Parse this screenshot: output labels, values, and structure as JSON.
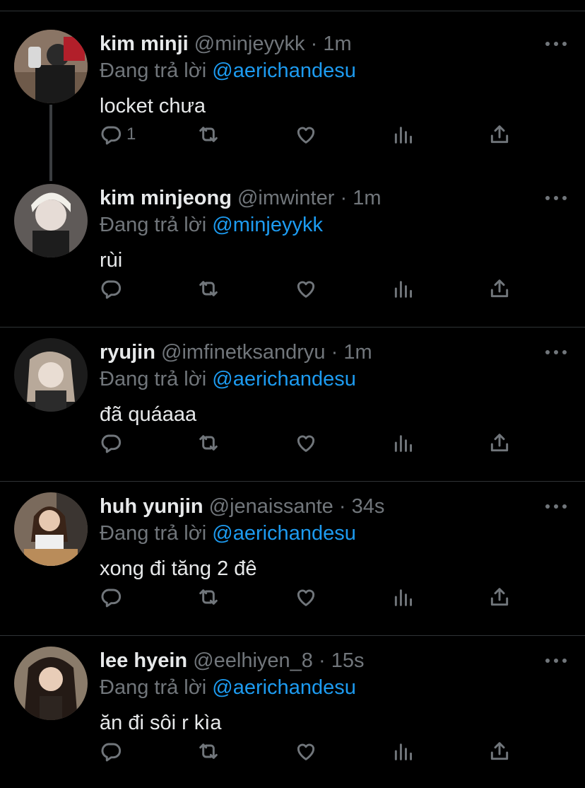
{
  "colors": {
    "background": "#000000",
    "text": "#e7e9ea",
    "muted": "#71767b",
    "link": "#1d9bf0",
    "divider": "#2f3336"
  },
  "reply_prefix": "Đang trả lời",
  "tweets": [
    {
      "name": "kim minji",
      "handle": "@minjeyykk",
      "dot": "·",
      "time": "1m",
      "reply_to": "@aerichandesu",
      "text": "locket chưa",
      "reply_count": "1",
      "avatar_icon": "avatar-photo"
    },
    {
      "name": "kim minjeong",
      "handle": "@imwinter",
      "dot": "·",
      "time": "1m",
      "reply_to": "@minjeyykk",
      "text": "rùi",
      "reply_count": "",
      "avatar_icon": "avatar-photo"
    },
    {
      "name": "ryujin",
      "handle": "@imfinetksandryu",
      "dot": "·",
      "time": "1m",
      "reply_to": "@aerichandesu",
      "text": "đã quáaaa",
      "reply_count": "",
      "avatar_icon": "avatar-photo"
    },
    {
      "name": "huh yunjin",
      "handle": "@jenaissante",
      "dot": "·",
      "time": "34s",
      "reply_to": "@aerichandesu",
      "text": "xong đi tăng 2 đê",
      "reply_count": "",
      "avatar_icon": "avatar-photo"
    },
    {
      "name": "lee hyein",
      "handle": "@eelhiyen_8",
      "dot": "·",
      "time": "15s",
      "reply_to": "@aerichandesu",
      "text": "ăn đi sôi r kìa",
      "reply_count": "",
      "avatar_icon": "avatar-photo"
    }
  ],
  "action_icons": [
    "reply-icon",
    "retweet-icon",
    "like-icon",
    "analytics-icon",
    "share-icon"
  ]
}
